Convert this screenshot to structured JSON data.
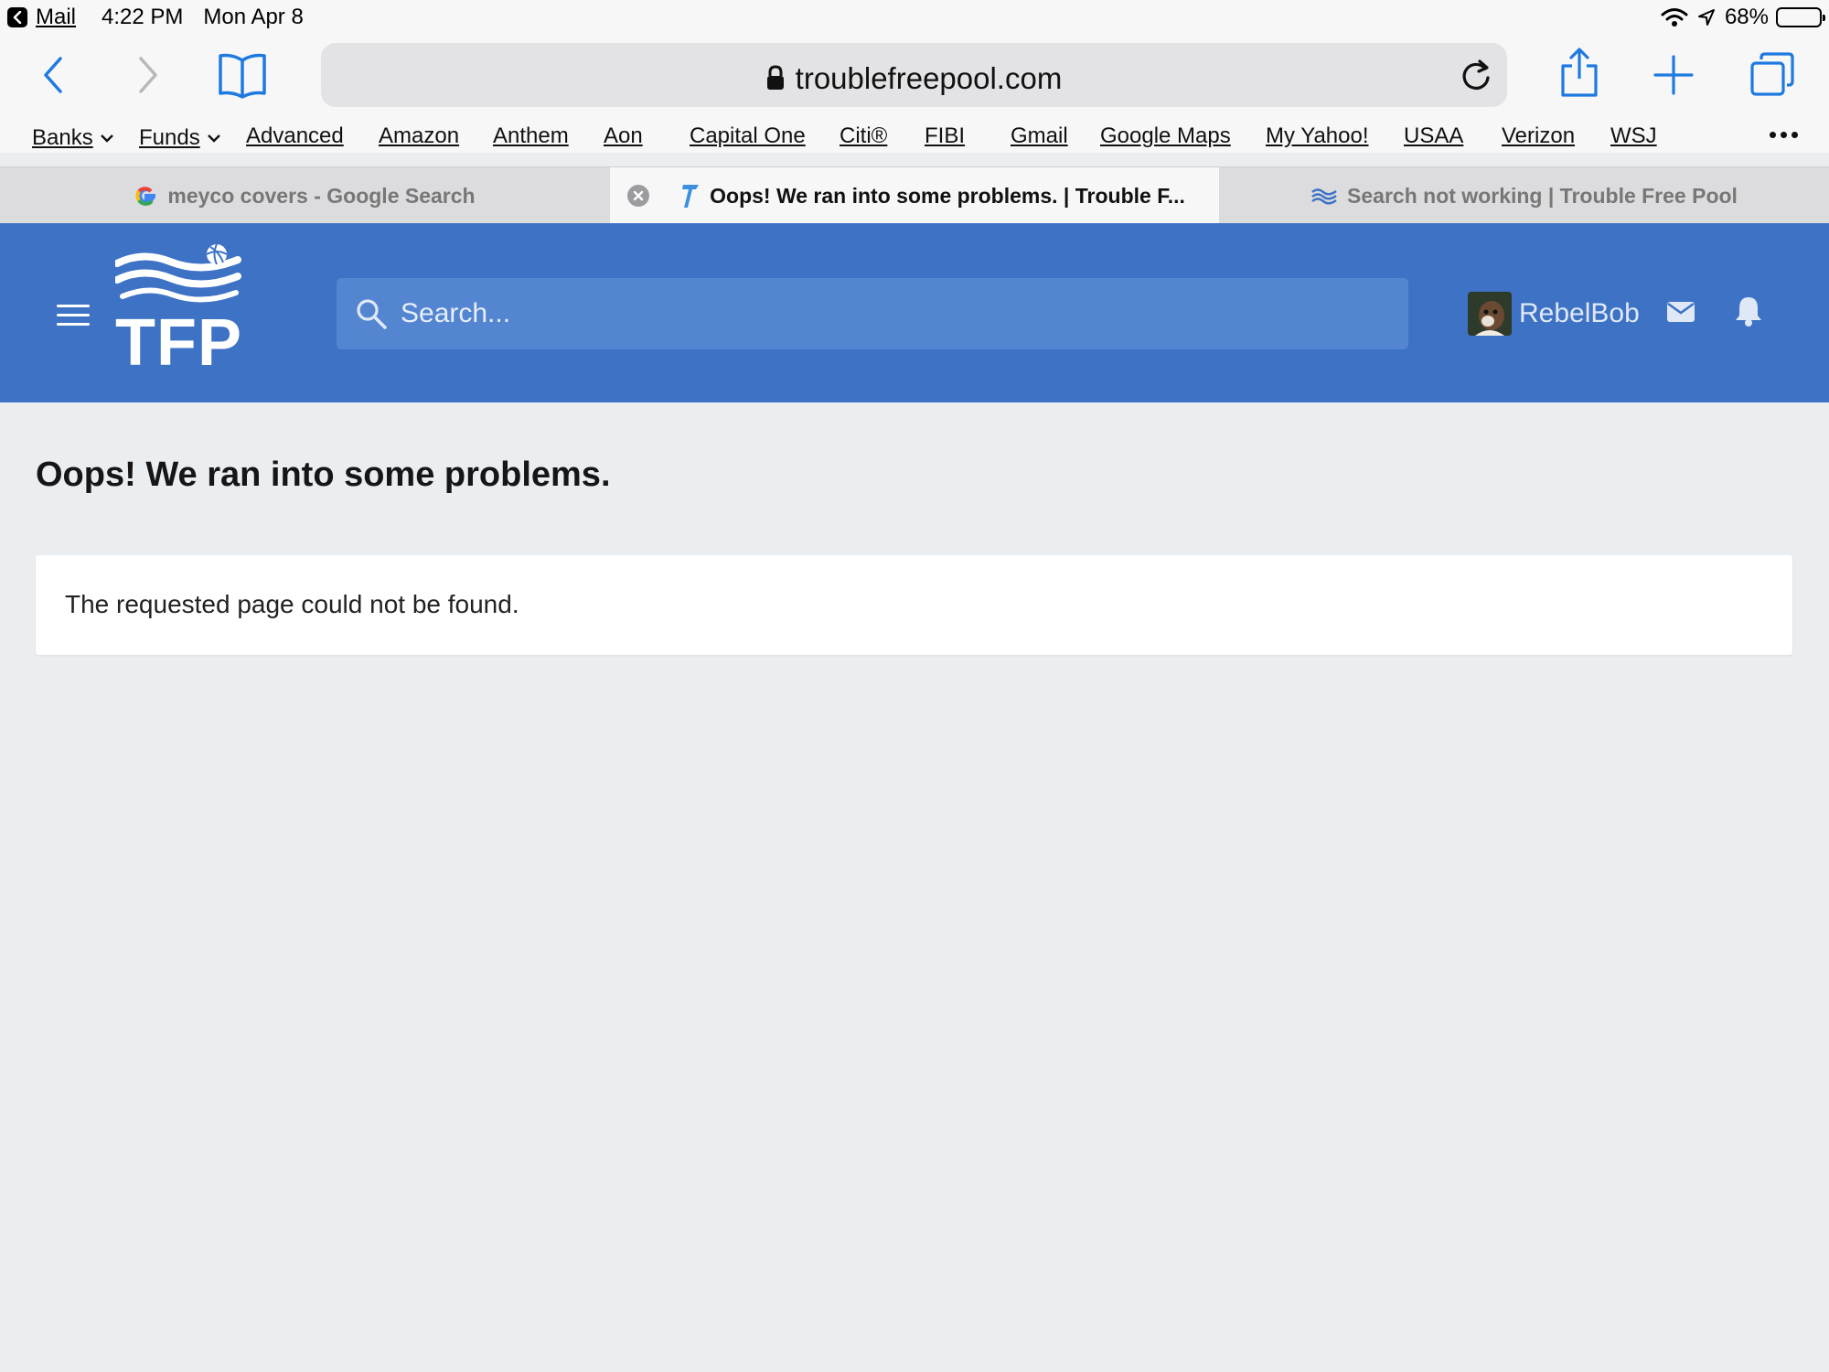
{
  "status_bar": {
    "back_app": "Mail",
    "time": "4:22 PM",
    "date": "Mon Apr 8",
    "battery": "68%",
    "battery_level": 0.68
  },
  "toolbar": {
    "url": "troublefreepool.com",
    "icons": [
      "back-icon",
      "forward-icon",
      "bookmarks-icon",
      "lock-icon",
      "reload-icon",
      "share-icon",
      "new-tab-icon",
      "tabs-icon"
    ]
  },
  "bookmarks": [
    {
      "label": "Banks",
      "folder": true
    },
    {
      "label": "Funds",
      "folder": true
    },
    {
      "label": "Advanced"
    },
    {
      "label": "Amazon"
    },
    {
      "label": "Anthem"
    },
    {
      "label": "Aon"
    },
    {
      "label": "Capital One"
    },
    {
      "label": "Citi®"
    },
    {
      "label": "FIBI"
    },
    {
      "label": "Gmail"
    },
    {
      "label": "Google Maps"
    },
    {
      "label": "My Yahoo!"
    },
    {
      "label": "USAA"
    },
    {
      "label": "Verizon"
    },
    {
      "label": "WSJ"
    }
  ],
  "tabs": [
    {
      "label": "meyco covers - Google Search",
      "active": false
    },
    {
      "label": "Oops! We ran into some problems. | Trouble F...",
      "active": true
    },
    {
      "label": "Search not working | Trouble Free Pool",
      "active": false
    }
  ],
  "site": {
    "logo_text": "TFP",
    "search_placeholder": "Search...",
    "username": "RebelBob"
  },
  "content": {
    "title": "Oops! We ran into some problems.",
    "message": "The requested page could not be found."
  },
  "colors": {
    "header_blue": "#3d72c4",
    "search_blue": "#5385d0",
    "ios_blue": "#1f7ae0",
    "page_bg": "#ebeef1"
  }
}
